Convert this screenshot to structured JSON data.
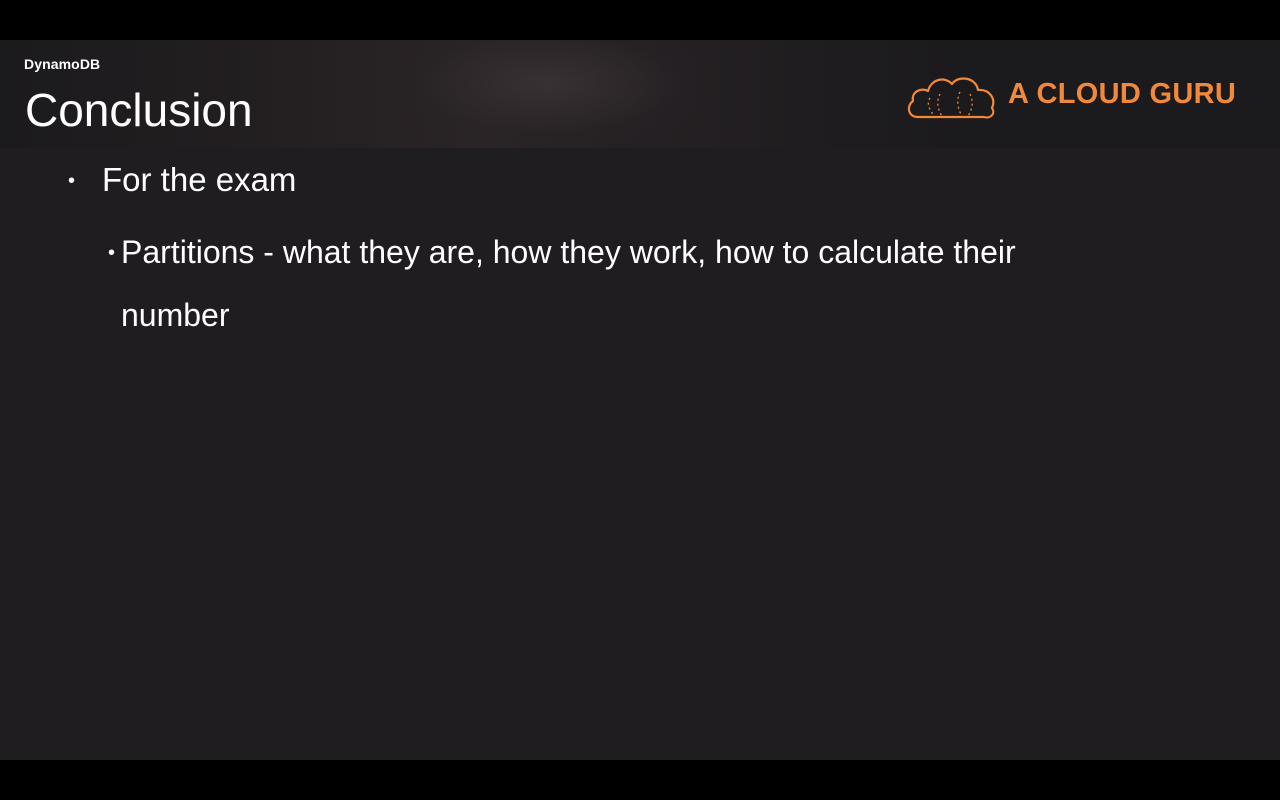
{
  "slide": {
    "section_label": "DynamoDB",
    "title": "Conclusion",
    "logo": {
      "text": "A CLOUD GURU",
      "icon": "cloud-icon",
      "color": "#f2883a"
    },
    "bullets": [
      {
        "text": "For the exam",
        "children": [
          {
            "line1": "Partitions - what they are, how they work, how to calculate their",
            "line2": "number"
          }
        ]
      }
    ]
  }
}
